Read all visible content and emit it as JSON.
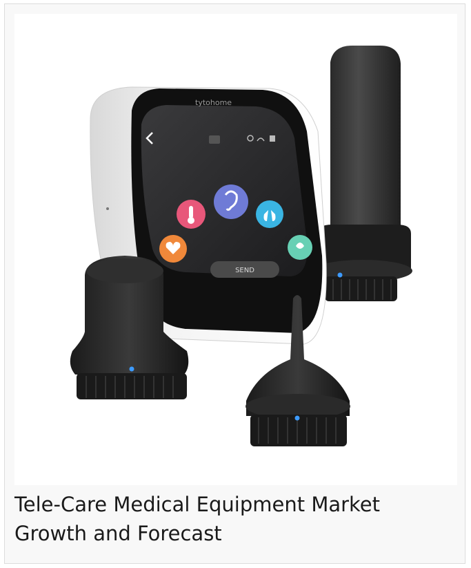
{
  "caption": "Tele-Care Medical Equipment Market Growth and Forecast",
  "product_image": {
    "brand_label": "tytohome",
    "send_button_label": "SEND",
    "icons": [
      "back-chevron-icon",
      "thermometer-icon",
      "ear-icon",
      "lungs-icon",
      "heart-icon",
      "skin-icon"
    ]
  }
}
